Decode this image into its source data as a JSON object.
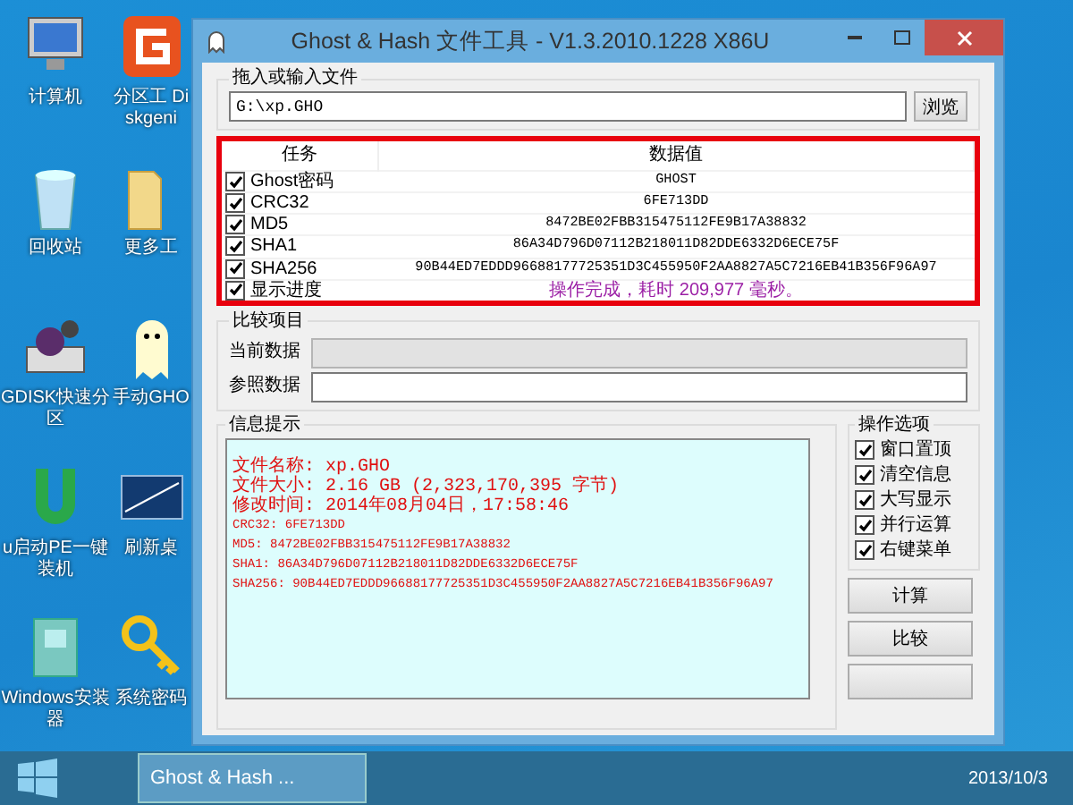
{
  "desktop_icons": [
    {
      "label": "计算机",
      "kind": "computer"
    },
    {
      "label": "分区工 Diskgeni",
      "kind": "partition"
    },
    {
      "label": "回收站",
      "kind": "bin"
    },
    {
      "label": "更多工",
      "kind": "folder"
    },
    {
      "label": "GDISK快速分区",
      "kind": "disk"
    },
    {
      "label": "手动GHO",
      "kind": "ghost"
    },
    {
      "label": "u启动PE一键装机",
      "kind": "u"
    },
    {
      "label": "刷新桌",
      "kind": "screen"
    },
    {
      "label": "Windows安装器",
      "kind": "installer"
    },
    {
      "label": "系统密码",
      "kind": "key"
    }
  ],
  "window": {
    "title": "Ghost & Hash 文件工具 - V1.3.2010.1228 X86U",
    "file_group": {
      "legend": "拖入或输入文件",
      "value": "G:\\xp.GHO",
      "browse_button": "浏览"
    },
    "table": {
      "columns": [
        "任务",
        "数据值"
      ],
      "rows": [
        {
          "task": "Ghost密码",
          "checked": true,
          "value": "GHOST",
          "kind": "plain"
        },
        {
          "task": "CRC32",
          "checked": true,
          "value": "6FE713DD",
          "kind": "plain"
        },
        {
          "task": "MD5",
          "checked": true,
          "value": "8472BE02FBB315475112FE9B17A38832",
          "kind": "plain"
        },
        {
          "task": "SHA1",
          "checked": true,
          "value": "86A34D796D07112B218011D82DDE6332D6ECE75F",
          "kind": "plain"
        },
        {
          "task": "SHA256",
          "checked": true,
          "value": "90B44ED7EDDD96688177725351D3C455950F2AA8827A5C7216EB41B356F96A97",
          "kind": "plain"
        },
        {
          "task": "显示进度",
          "checked": true,
          "value": "操作完成，耗时 209,977 毫秒。",
          "kind": "status"
        }
      ]
    },
    "compare_group": {
      "legend": "比较项目",
      "fields": [
        {
          "label": "当前数据",
          "disabled": true
        },
        {
          "label": "参照数据",
          "disabled": false
        }
      ]
    },
    "info_group": {
      "legend": "信息提示",
      "lines": [
        "文件名称: xp.GHO",
        "文件大小: 2.16 GB (2,323,170,395 字节)",
        "修改时间: 2014年08月04日，17:58:46",
        "CRC32: 6FE713DD",
        "MD5: 8472BE02FBB315475112FE9B17A38832",
        "SHA1: 86A34D796D07112B218011D82DDE6332D6ECE75F",
        "SHA256: 90B44ED7EDDD96688177725351D3C455950F2AA8827A5C7216EB41B356F96A97"
      ]
    },
    "options_group": {
      "legend": "操作选项",
      "options": [
        {
          "label": "窗口置顶",
          "checked": true
        },
        {
          "label": "清空信息",
          "checked": true
        },
        {
          "label": "大写显示",
          "checked": true
        },
        {
          "label": "并行运算",
          "checked": true
        },
        {
          "label": "右键菜单",
          "checked": true
        }
      ]
    },
    "buttons": [
      "计算",
      "比较"
    ]
  },
  "taskbar": {
    "task": "Ghost & Hash ...",
    "date": "2013/10/3"
  }
}
